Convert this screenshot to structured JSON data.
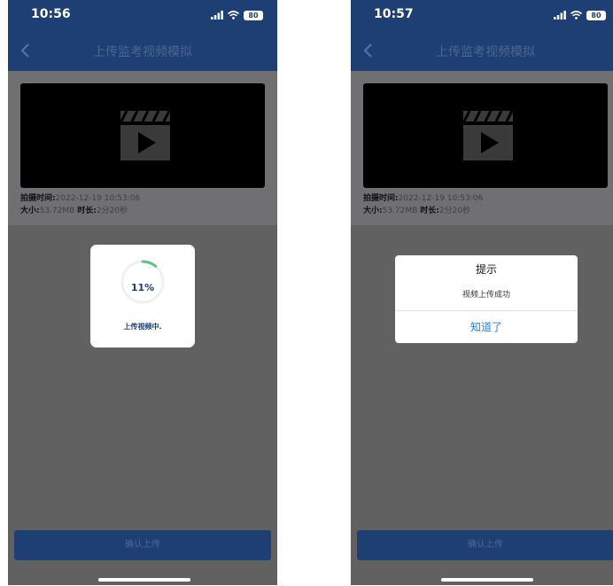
{
  "screens": [
    {
      "status_bar": {
        "time": "10:56",
        "battery": "80"
      },
      "nav": {
        "back_icon": "chevron-left-icon",
        "title": "上传监考视频模拟"
      },
      "video": {
        "icon": "video-clapper-icon",
        "shot_time_label": "拍摄时间:",
        "shot_time_value": "2022-12-19 10:53:06",
        "size_label": "大小:",
        "size_value": "53.72MB",
        "duration_label": "时长:",
        "duration_value": "2分20秒"
      },
      "progress_dialog": {
        "percent": "11%",
        "progress_value": 11,
        "status": "上传视频中."
      },
      "submit_button": "确认上传"
    },
    {
      "status_bar": {
        "time": "10:57",
        "battery": "80"
      },
      "nav": {
        "back_icon": "chevron-left-icon",
        "title": "上传监考视频模拟"
      },
      "video": {
        "icon": "video-clapper-icon",
        "shot_time_label": "拍摄时间:",
        "shot_time_value": "2022-12-19 10:53:06",
        "size_label": "大小:",
        "size_value": "53.72MB",
        "duration_label": "时长:",
        "duration_value": "2分20秒"
      },
      "alert_dialog": {
        "title": "提示",
        "message": "视频上传成功",
        "button": "知道了"
      },
      "submit_button": "确认上传"
    }
  ],
  "colors": {
    "primary": "#1e3f74",
    "overlay_bg": "#616162",
    "progress_arc": "#5cc47f",
    "alert_button_text": "#2f7de0"
  }
}
